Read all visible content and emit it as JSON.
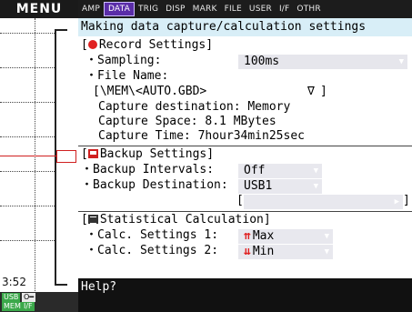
{
  "menu": {
    "title": "MENU"
  },
  "left_panel": {
    "time_label": "3:52",
    "status": {
      "usb": "USB",
      "key": "O━",
      "mem": "MEM",
      "if": "I/F"
    }
  },
  "tabs": [
    {
      "label": "AMP",
      "active": false
    },
    {
      "label": "DATA",
      "active": true
    },
    {
      "label": "TRIG",
      "active": false
    },
    {
      "label": "DISP",
      "active": false
    },
    {
      "label": "MARK",
      "active": false
    },
    {
      "label": "FILE",
      "active": false
    },
    {
      "label": "USER",
      "active": false
    },
    {
      "label": "I/F",
      "active": false
    },
    {
      "label": "OTHR",
      "active": false
    }
  ],
  "banner": "Making data capture/calculation settings",
  "record": {
    "title": "Record Settings]",
    "open_bracket": "[",
    "sampling_label": "・Sampling:",
    "sampling_value": "100ms",
    "file_name_label": "・File Name:",
    "file_name_value": "[\\MEM\\<AUTO.GBD>",
    "file_browse_icon": "∇",
    "file_close": "]",
    "capture_destination": "Capture destination: Memory",
    "capture_space": "Capture Space:   8.1 MBytes",
    "capture_time": "Capture Time:   7hour34min25sec"
  },
  "backup": {
    "title": "Backup Settings]",
    "open_bracket": "[",
    "intervals_label": "・Backup Intervals:",
    "intervals_value": "Off",
    "destination_label": "・Backup Destination:",
    "destination_value": "USB1",
    "path_open": "[",
    "path_value": "",
    "path_close": "]"
  },
  "stats": {
    "title": "Statistical Calculation]",
    "open_bracket": "[",
    "calc1_label": "・Calc. Settings 1:",
    "calc1_value": "Max",
    "calc2_label": "・Calc. Settings 2:",
    "calc2_value": "Min"
  },
  "help": "Help?",
  "colors": {
    "accent": "#5a2da8",
    "banner": "#d8eef7",
    "warn": "#e02020"
  }
}
